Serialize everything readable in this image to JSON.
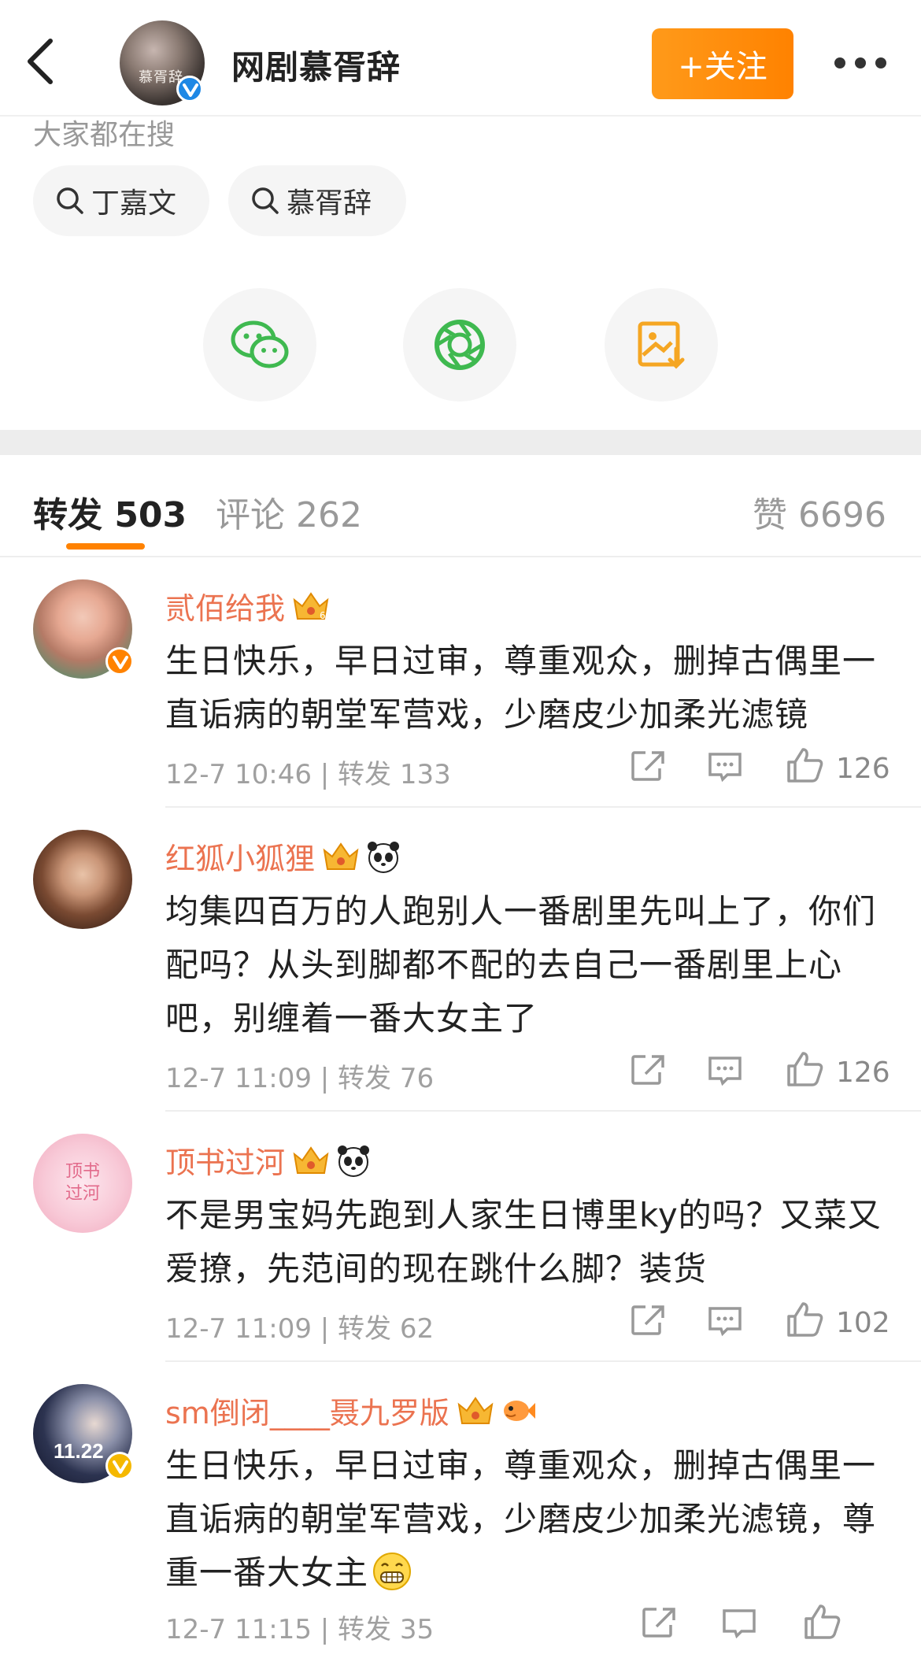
{
  "header": {
    "title": "网剧慕胥辞",
    "follow_label": "+关注",
    "avatar_text": "慕胥辞"
  },
  "search": {
    "label": "大家都在搜",
    "chips": [
      "丁嘉文",
      "慕胥辞"
    ]
  },
  "share": {
    "icons": [
      "wechat-icon",
      "moments-icon",
      "save-image-icon"
    ]
  },
  "tabs": {
    "repost": "转发 503",
    "comment": "评论 262",
    "like": "赞 6696"
  },
  "comments": [
    {
      "name": "贰佰给我",
      "text": "生日快乐，早日过审，尊重观众，删掉古偶里一直诟病的朝堂军营戏，少磨皮少加柔光滤镜",
      "meta": "12-7 10:46 | 转发 133",
      "likes": "126",
      "badges": [
        "vip-crown-icon"
      ]
    },
    {
      "name": "红狐小狐狸",
      "text": "均集四百万的人跑别人一番剧里先叫上了，你们配吗？从头到脚都不配的去自己一番剧里上心吧，别缠着一番大女主了",
      "meta": "12-7 11:09 | 转发 76",
      "likes": "126",
      "badges": [
        "vip-crown-icon",
        "panda-icon"
      ]
    },
    {
      "name": "顶书过河",
      "text": "不是男宝妈先跑到人家生日博里ky的吗？又菜又爱撩，先范间的现在跳什么脚？装货",
      "meta": "12-7 11:09 | 转发 62",
      "likes": "102",
      "badges": [
        "vip-crown-icon",
        "panda-icon"
      ]
    },
    {
      "name": "sm倒闭____聂九罗版",
      "text": "生日快乐，早日过审，尊重观众，删掉古偶里一直诟病的朝堂军营戏，少磨皮少加柔光滤镜，尊重一番大女主",
      "meta": "12-7 11:15 | 转发 35",
      "likes": "",
      "badges": [
        "vip-crown-icon",
        "fish-icon"
      ],
      "avatar_text": "11.22"
    }
  ],
  "avatar3_text": "顶书过河",
  "colors": {
    "accent": "#ff8200",
    "name": "#eb7350",
    "verified_blue": "#1e88e5"
  }
}
